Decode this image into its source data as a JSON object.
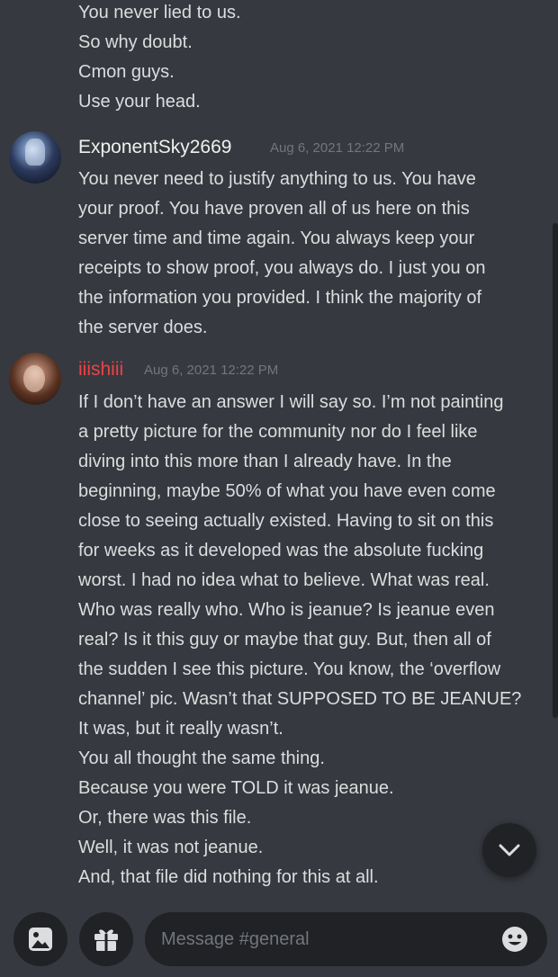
{
  "messages": {
    "top_continuation": [
      "You never lied to us.",
      "So why doubt.",
      "Cmon guys.",
      "Use your head."
    ],
    "msg1": {
      "author": "ExponentSky2669",
      "timestamp": "Aug 6, 2021 12:22 PM",
      "lines": [
        "You never need to justify anything to us. You have",
        "your proof. You have proven all of us here on this",
        "server time and time again. You always keep your",
        "receipts to show proof, you always do. I just you on",
        "the information you provided. I think the majority of",
        "the server does."
      ]
    },
    "msg2": {
      "author": "iiishiii",
      "timestamp": "Aug 6, 2021 12:22 PM",
      "author_color": "#ed4245",
      "lines": [
        "If I don’t have an answer I will say so. I’m not painting",
        "a pretty picture for the community nor do I feel like",
        "diving into this more than I already have. In the",
        "beginning, maybe 50% of what you have even come",
        "close to seeing actually existed. Having to sit on this",
        "for weeks as it developed was the absolute fucking",
        "worst. I had no idea what to believe. What was real.",
        "Who was really who. Who is jeanue? Is jeanue even",
        "real? Is it this guy or maybe that guy. But, then all of",
        "the sudden I see this picture. You know, the ‘overflow",
        "channel’ pic. Wasn’t that SUPPOSED TO BE JEANUE?",
        "It was, but it really wasn’t.",
        "You all thought the same thing.",
        "Because you were TOLD it was jeanue.",
        "Or, there was this file.",
        "Well, it was not jeanue.",
        "And, that file did nothing for this at all."
      ]
    }
  },
  "composer": {
    "placeholder": "Message #general"
  },
  "icons": {
    "image": "image-icon",
    "gift": "gift-icon",
    "emoji": "emoji-icon",
    "jump": "chevron-down-icon"
  },
  "colors": {
    "background": "#36393f",
    "input_bg": "#202225",
    "text": "#dcddde",
    "muted": "#72767d",
    "role_red": "#ed4245"
  }
}
